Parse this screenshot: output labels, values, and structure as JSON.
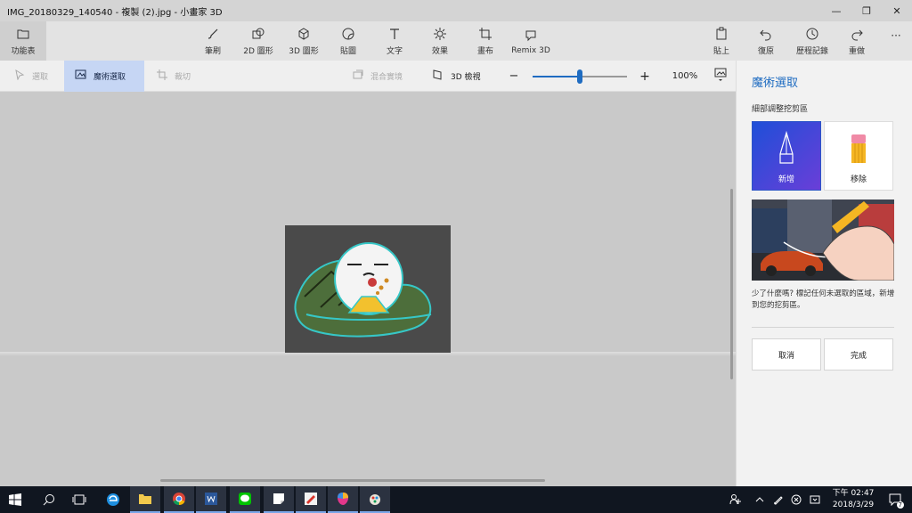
{
  "window": {
    "title": "IMG_20180329_140540 - 複製 (2).jpg - 小畫家 3D",
    "minimize": "—",
    "restore": "❐",
    "close": "✕"
  },
  "ribbon": {
    "menu": "功能表",
    "tools": [
      {
        "label": "筆刷",
        "icon": "brush-icon"
      },
      {
        "label": "2D 圖形",
        "icon": "2d-shapes-icon"
      },
      {
        "label": "3D 圖形",
        "icon": "3d-shapes-icon"
      },
      {
        "label": "貼圖",
        "icon": "stickers-icon"
      },
      {
        "label": "文字",
        "icon": "text-icon"
      },
      {
        "label": "效果",
        "icon": "effects-icon"
      },
      {
        "label": "畫布",
        "icon": "canvas-icon"
      },
      {
        "label": "Remix 3D",
        "icon": "remix-3d-icon"
      }
    ],
    "right": [
      {
        "label": "貼上",
        "icon": "paste-icon"
      },
      {
        "label": "復原",
        "icon": "undo-icon"
      },
      {
        "label": "歷程記錄",
        "icon": "history-icon"
      },
      {
        "label": "重做",
        "icon": "redo-icon"
      }
    ],
    "more": "···"
  },
  "toolbar": {
    "select": "選取",
    "magic_select": "魔術選取",
    "crop": "裁切",
    "mixed_reality": "混合實境",
    "view_3d": "3D 檢視",
    "zoom_minus": "−",
    "zoom_plus": "+",
    "zoom": "100%",
    "zoom_level": 0.5
  },
  "panel": {
    "title": "魔術選取",
    "subtitle": "細部調整挖剪區",
    "add": "新增",
    "remove": "移除",
    "tip": "少了什麼嗎? 標記任何未選取的區域，新增到您的挖剪區。",
    "cancel": "取消",
    "done": "完成"
  },
  "taskbar": {
    "apps": [
      "windows-start-icon",
      "search-icon",
      "task-view-icon",
      "edge-icon",
      "file-explorer-icon",
      "chrome-icon",
      "word-icon",
      "line-icon",
      "sticky-notes-icon",
      "paint-icon",
      "paint-3d-icon",
      "fresh-paint-icon"
    ],
    "time": "下午 02:47",
    "date": "2018/3/29",
    "notifications": "7"
  },
  "colors": {
    "accent": "#1f6cc1",
    "add_card": "#3d48d8",
    "taskbar": "#101620"
  }
}
